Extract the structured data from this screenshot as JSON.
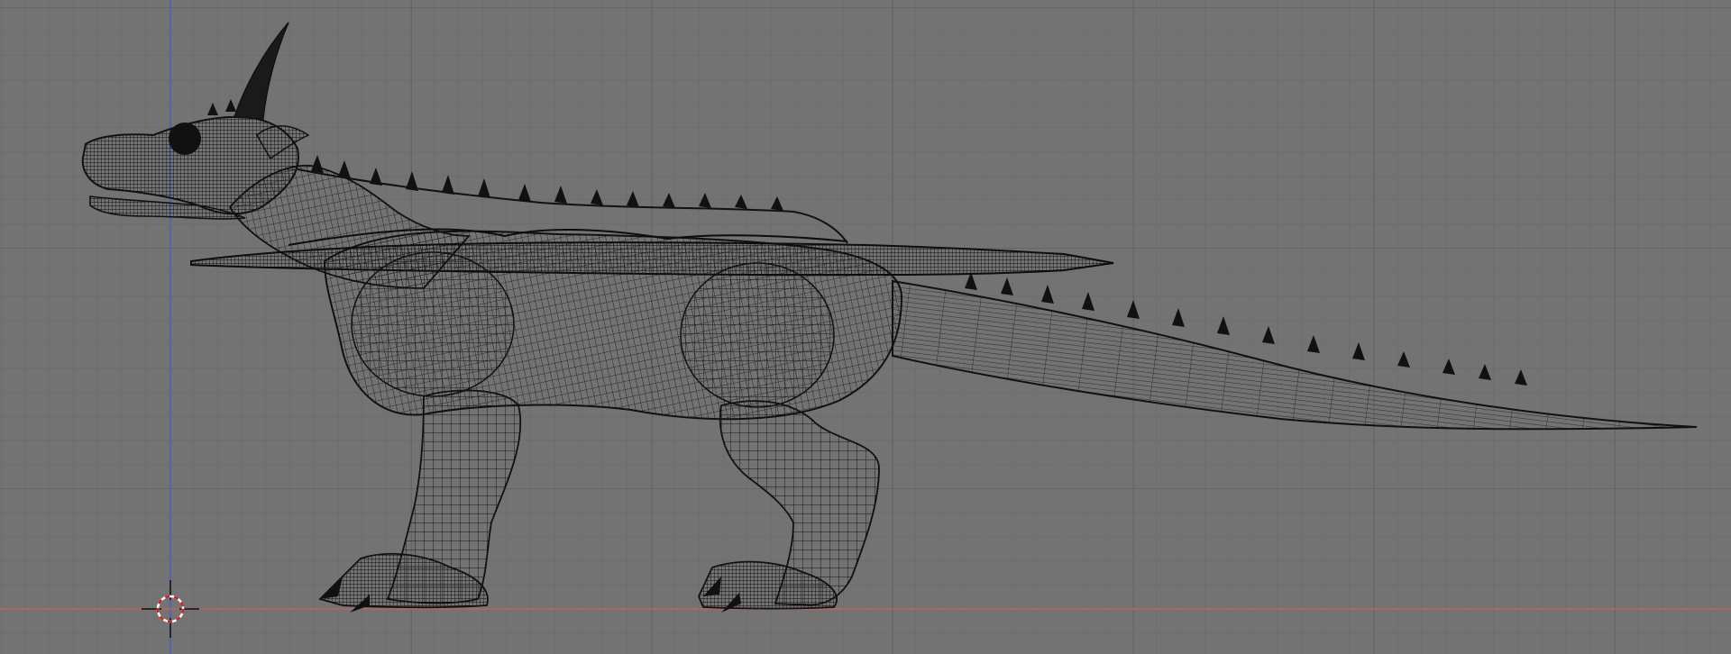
{
  "viewport": {
    "view": "side-orthographic",
    "shading": "wireframe",
    "background_color": "#737373",
    "grid_color": "#666666",
    "grid_major_color": "#5e5e5e",
    "x_axis_color": "#c06060",
    "z_axis_color": "#5060c0",
    "wire_color": "#101010",
    "cursor_colors": [
      "#ffffff",
      "#d02020"
    ]
  },
  "model": {
    "object": "dragon",
    "icon": "dragon-mesh"
  },
  "overlays": {
    "cursor_icon": "3d-cursor-icon"
  }
}
